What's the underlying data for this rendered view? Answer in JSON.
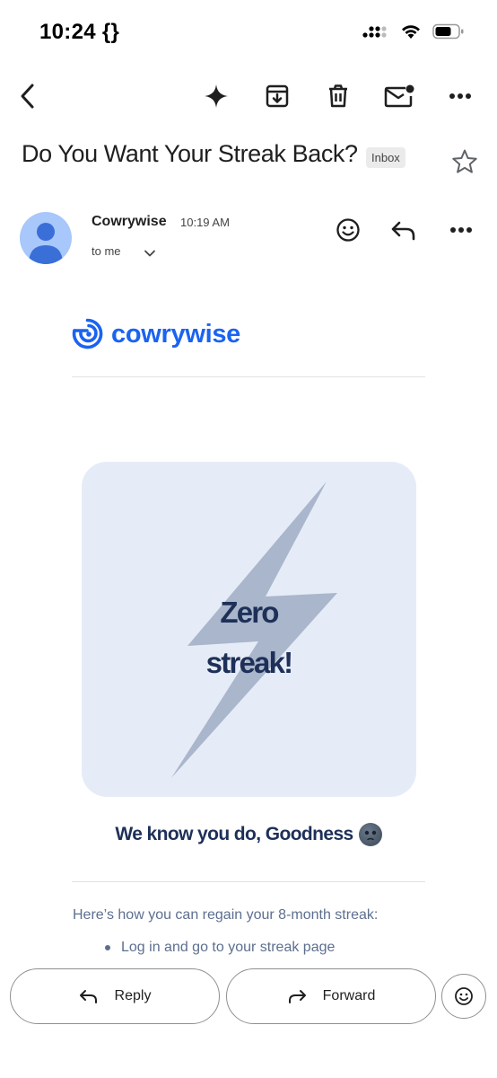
{
  "status_bar": {
    "time": "10:24 {}"
  },
  "toolbar": {
    "back_icon": "back-arrow-icon",
    "icons": [
      "sparkle-icon",
      "archive-icon",
      "trash-icon",
      "mark-unread-icon",
      "more-icon"
    ]
  },
  "email": {
    "subject": "Do You Want Your Streak Back?",
    "label": "Inbox",
    "sender": "Cowrywise",
    "time": "10:19 AM",
    "to": "to me"
  },
  "body": {
    "brand": "cowrywise",
    "hero_line1": "Zero",
    "hero_line2": "streak!",
    "greeting": "We know you do, Goodness",
    "intro": "Here’s how you can regain your 8-month streak:",
    "steps": [
      "Log in and go to your streak page"
    ]
  },
  "actions": {
    "reply": "Reply",
    "forward": "Forward"
  },
  "colors": {
    "brand": "#1a63f2",
    "hero_bg": "#e6ecf7",
    "hero_text": "#1e3058",
    "body_text": "#5d6f8f"
  }
}
